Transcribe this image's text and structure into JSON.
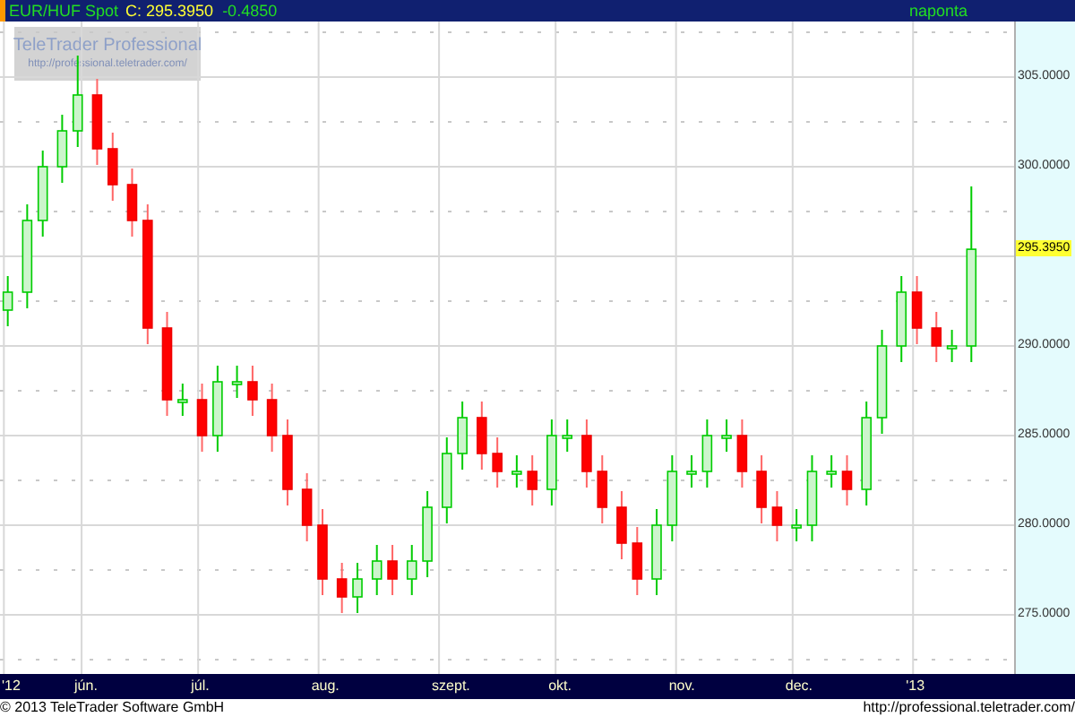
{
  "header": {
    "symbol": "EUR/HUF Spot",
    "close": "C: 295.3950",
    "change": "-0.4850",
    "interval": "naponta"
  },
  "watermark": {
    "title": "TeleTrader Professional",
    "url": "http://professional.teletrader.com/"
  },
  "chart": {
    "last_price": "295.3950",
    "chart_data": {
      "type": "candlestick",
      "grid": true,
      "xlim": [
        "2012-05-11",
        "2013-01-27"
      ],
      "ylim": [
        271.7,
        308.1
      ],
      "yticks": [
        {
          "value": 275,
          "label": "275.0000"
        },
        {
          "value": 280,
          "label": "280.0000"
        },
        {
          "value": 285,
          "label": "285.0000"
        },
        {
          "value": 290,
          "label": "290.0000"
        },
        {
          "value": 300,
          "label": "300.0000"
        },
        {
          "value": 305,
          "label": "305.0000"
        }
      ],
      "xticks": [
        {
          "value": "2012-05-12",
          "label": "'12"
        },
        {
          "value": "2012-06-01",
          "label": "jún."
        },
        {
          "value": "2012-07-01",
          "label": "júl."
        },
        {
          "value": "2012-08-01",
          "label": "aug."
        },
        {
          "value": "2012-09-01",
          "label": "szept."
        },
        {
          "value": "2012-10-01",
          "label": "okt."
        },
        {
          "value": "2012-11-01",
          "label": "nov."
        },
        {
          "value": "2012-12-01",
          "label": "dec."
        },
        {
          "value": "2013-01-01",
          "label": "'13"
        }
      ],
      "x": [
        "2012-05-13",
        "2012-05-18",
        "2012-05-22",
        "2012-05-27",
        "2012-05-31",
        "2012-06-05",
        "2012-06-09",
        "2012-06-14",
        "2012-06-18",
        "2012-06-23",
        "2012-06-27",
        "2012-07-02",
        "2012-07-06",
        "2012-07-11",
        "2012-07-15",
        "2012-07-20",
        "2012-07-24",
        "2012-07-29",
        "2012-08-02",
        "2012-08-07",
        "2012-08-11",
        "2012-08-16",
        "2012-08-20",
        "2012-08-25",
        "2012-08-29",
        "2012-09-03",
        "2012-09-07",
        "2012-09-12",
        "2012-09-16",
        "2012-09-21",
        "2012-09-25",
        "2012-09-30",
        "2012-10-04",
        "2012-10-09",
        "2012-10-13",
        "2012-10-18",
        "2012-10-22",
        "2012-10-27",
        "2012-10-31",
        "2012-11-05",
        "2012-11-09",
        "2012-11-14",
        "2012-11-18",
        "2012-11-23",
        "2012-11-27",
        "2012-12-02",
        "2012-12-06",
        "2012-12-11",
        "2012-12-15",
        "2012-12-20",
        "2012-12-24",
        "2012-12-29",
        "2013-01-02",
        "2013-01-07",
        "2013-01-11",
        "2013-01-16"
      ],
      "ohlc": [
        [
          292,
          293.9,
          291.1,
          293
        ],
        [
          293,
          297.9,
          292.1,
          297
        ],
        [
          297,
          300.9,
          296.1,
          300
        ],
        [
          300,
          302.9,
          299.1,
          302
        ],
        [
          302,
          306.2,
          301.1,
          304
        ],
        [
          304,
          304.9,
          300.1,
          301
        ],
        [
          301,
          301.9,
          298.1,
          299
        ],
        [
          299,
          299.9,
          296.1,
          297
        ],
        [
          297,
          297.9,
          290.1,
          291
        ],
        [
          291,
          291.9,
          286.1,
          287
        ],
        [
          287,
          287.9,
          286.1,
          287
        ],
        [
          287,
          287.9,
          284.1,
          285
        ],
        [
          285,
          288.9,
          284.1,
          288
        ],
        [
          288,
          288.9,
          287.1,
          288
        ],
        [
          288,
          288.9,
          286.1,
          287
        ],
        [
          287,
          287.9,
          284.1,
          285
        ],
        [
          285,
          285.9,
          281.1,
          282
        ],
        [
          282,
          282.9,
          279.1,
          280
        ],
        [
          280,
          280.9,
          276.1,
          277
        ],
        [
          277,
          277.9,
          275.1,
          276
        ],
        [
          276,
          277.9,
          275.1,
          277
        ],
        [
          277,
          278.9,
          276.1,
          278
        ],
        [
          278,
          278.9,
          276.1,
          277
        ],
        [
          277,
          278.9,
          276.1,
          278
        ],
        [
          278,
          281.9,
          277.1,
          281
        ],
        [
          281,
          284.9,
          280.1,
          284
        ],
        [
          284,
          286.9,
          283.1,
          286
        ],
        [
          286,
          286.9,
          283.1,
          284
        ],
        [
          284,
          284.9,
          282.1,
          283
        ],
        [
          283,
          283.9,
          282.1,
          283
        ],
        [
          283,
          283.9,
          281.1,
          282
        ],
        [
          282,
          285.9,
          281.1,
          285
        ],
        [
          285,
          285.9,
          284.1,
          285
        ],
        [
          285,
          285.9,
          282.1,
          283
        ],
        [
          283,
          283.9,
          280.1,
          281
        ],
        [
          281,
          281.9,
          278.1,
          279
        ],
        [
          279,
          279.9,
          276.1,
          277
        ],
        [
          277,
          280.9,
          276.1,
          280
        ],
        [
          280,
          283.9,
          279.1,
          283
        ],
        [
          283,
          283.9,
          282.1,
          283
        ],
        [
          283,
          285.9,
          282.1,
          285
        ],
        [
          285,
          285.9,
          284.1,
          285
        ],
        [
          285,
          285.9,
          282.1,
          283
        ],
        [
          283,
          283.9,
          280.1,
          281
        ],
        [
          281,
          281.9,
          279.1,
          280
        ],
        [
          280,
          280.9,
          279.1,
          280
        ],
        [
          280,
          283.9,
          279.1,
          283
        ],
        [
          283,
          283.9,
          282.1,
          283
        ],
        [
          283,
          283.9,
          281.1,
          282
        ],
        [
          282,
          286.9,
          281.1,
          286
        ],
        [
          286,
          290.9,
          285.1,
          290
        ],
        [
          290,
          293.9,
          289.1,
          293
        ],
        [
          293,
          293.9,
          290.1,
          291
        ],
        [
          291,
          291.9,
          289.1,
          290
        ],
        [
          290,
          290.9,
          289.1,
          290
        ],
        [
          290,
          298.9,
          289.1,
          295.395
        ]
      ]
    }
  },
  "footer": {
    "copyright": "© 2013 TeleTrader Software GmbH",
    "url": "http://professional.teletrader.com/"
  }
}
